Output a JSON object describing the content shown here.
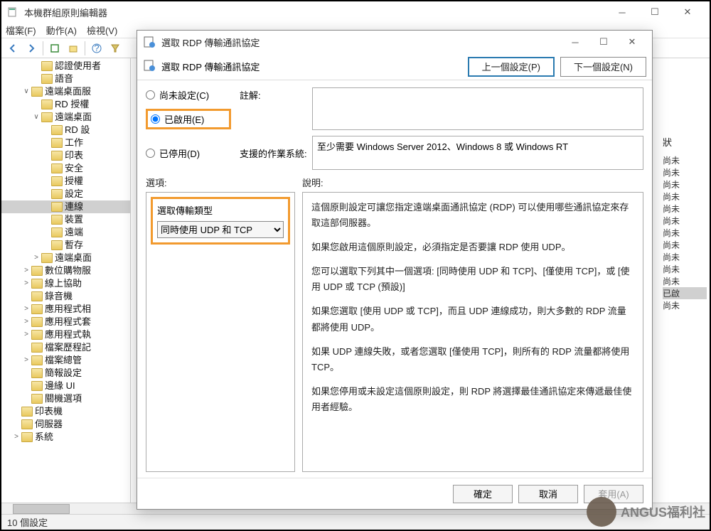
{
  "outer": {
    "title": "本機群組原則編輯器",
    "menus": {
      "file": "檔案(F)",
      "action": "動作(A)",
      "view": "檢視(V)"
    }
  },
  "tree": [
    {
      "indent": 3,
      "label": "認證使用者"
    },
    {
      "indent": 3,
      "label": "語音"
    },
    {
      "indent": 2,
      "label": "遠端桌面服",
      "twisty": "∨"
    },
    {
      "indent": 3,
      "label": "RD 授權"
    },
    {
      "indent": 3,
      "label": "遠端桌面",
      "twisty": "∨"
    },
    {
      "indent": 4,
      "label": "RD 設"
    },
    {
      "indent": 4,
      "label": "工作"
    },
    {
      "indent": 4,
      "label": "印表"
    },
    {
      "indent": 4,
      "label": "安全"
    },
    {
      "indent": 4,
      "label": "授權"
    },
    {
      "indent": 4,
      "label": "設定"
    },
    {
      "indent": 4,
      "label": "連線",
      "selected": true
    },
    {
      "indent": 4,
      "label": "裝置"
    },
    {
      "indent": 4,
      "label": "遠端"
    },
    {
      "indent": 4,
      "label": "暫存"
    },
    {
      "indent": 3,
      "label": "遠端桌面",
      "twisty": ">"
    },
    {
      "indent": 2,
      "label": "數位購物服",
      "twisty": ">"
    },
    {
      "indent": 2,
      "label": "線上協助",
      "twisty": ">"
    },
    {
      "indent": 2,
      "label": "錄音機"
    },
    {
      "indent": 2,
      "label": "應用程式相",
      "twisty": ">"
    },
    {
      "indent": 2,
      "label": "應用程式套",
      "twisty": ">"
    },
    {
      "indent": 2,
      "label": "應用程式執",
      "twisty": ">"
    },
    {
      "indent": 2,
      "label": "檔案歷程記"
    },
    {
      "indent": 2,
      "label": "檔案總管",
      "twisty": ">"
    },
    {
      "indent": 2,
      "label": "簡報設定"
    },
    {
      "indent": 2,
      "label": "邊緣 UI"
    },
    {
      "indent": 2,
      "label": "關機選項"
    },
    {
      "indent": 1,
      "label": "印表機"
    },
    {
      "indent": 1,
      "label": "伺服器"
    },
    {
      "indent": 1,
      "label": "系統",
      "twisty": ">"
    }
  ],
  "statusStrip": {
    "header": "狀",
    "rows": [
      "尚未",
      "尚未",
      "尚未",
      "尚未",
      "尚未",
      "尚未",
      "尚未",
      "尚未",
      "尚未",
      "尚未",
      "尚未"
    ],
    "special": "已啟",
    "tail": "尚未"
  },
  "dialog": {
    "title": "選取 RDP 傳輸通訊協定",
    "subtitle": "選取 RDP 傳輸通訊協定",
    "prevBtn": "上一個設定(P)",
    "nextBtn": "下一個設定(N)",
    "radios": {
      "notconf": "尚未設定(C)",
      "enabled": "已啟用(E)",
      "disabled": "已停用(D)"
    },
    "commentLabel": "註解:",
    "supportedLabel": "支援的作業系統:",
    "supportedText": "至少需要 Windows Server 2012、Windows 8 或 Windows RT",
    "optionsHdr": "選項:",
    "descHdr": "說明:",
    "optLabel": "選取傳輸類型",
    "optValue": "同時使用 UDP 和 TCP",
    "desc": {
      "p1": "這個原則設定可讓您指定遠端桌面通訊協定 (RDP) 可以使用哪些通訊協定來存取這部伺服器。",
      "p2": "如果您啟用這個原則設定，必須指定是否要讓 RDP 使用 UDP。",
      "p3": "您可以選取下列其中一個選項: [同時使用 UDP 和 TCP]、[僅使用 TCP]，或 [使用 UDP 或 TCP (預設)]",
      "p4": "如果您選取 [使用 UDP 或 TCP]，而且 UDP 連線成功，則大多數的 RDP 流量都將使用 UDP。",
      "p5": "如果 UDP 連線失敗，或者您選取 [僅使用 TCP]，則所有的 RDP 流量都將使用 TCP。",
      "p6": "如果您停用或未設定這個原則設定，則 RDP 將選擇最佳通訊協定來傳遞最佳使用者經驗。"
    },
    "footer": {
      "ok": "確定",
      "cancel": "取消",
      "apply": "套用(A)"
    }
  },
  "statusbar": "10 個設定",
  "watermark": {
    "name": "ANGUS福利社",
    "url": "https://wuangus.cc"
  }
}
